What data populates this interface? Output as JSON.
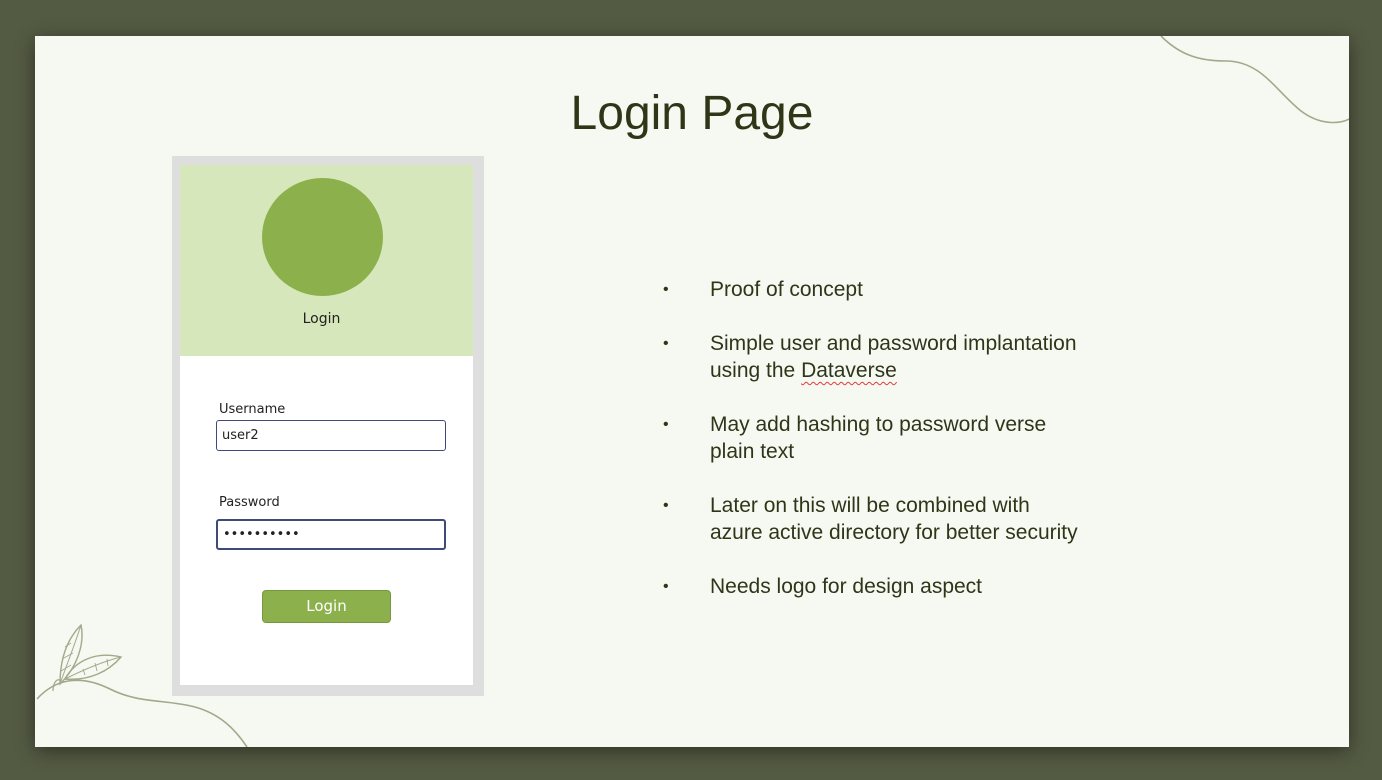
{
  "slide": {
    "title": "Login Page",
    "background_color": "#f6f8f2",
    "frame_color": "#545b43",
    "accent_color": "#8cb14c"
  },
  "mockup": {
    "header_label": "Login",
    "avatar_color": "#8cb14c",
    "header_color": "#d6e8bb",
    "username": {
      "label": "Username",
      "value": "user2"
    },
    "password": {
      "label": "Password",
      "value": "••••••••••"
    },
    "login_button": "Login"
  },
  "bullets": [
    {
      "text": "Proof of concept"
    },
    {
      "text_before": "Simple user and password implantation using the ",
      "flagged_word": "Dataverse"
    },
    {
      "text": "May add hashing to password verse plain text"
    },
    {
      "text": "Later on this will be combined with azure active directory for better security"
    },
    {
      "text": "Needs logo for design aspect"
    }
  ],
  "decorations": [
    "curve-line-top-right",
    "leaf-branch-bottom-left"
  ]
}
